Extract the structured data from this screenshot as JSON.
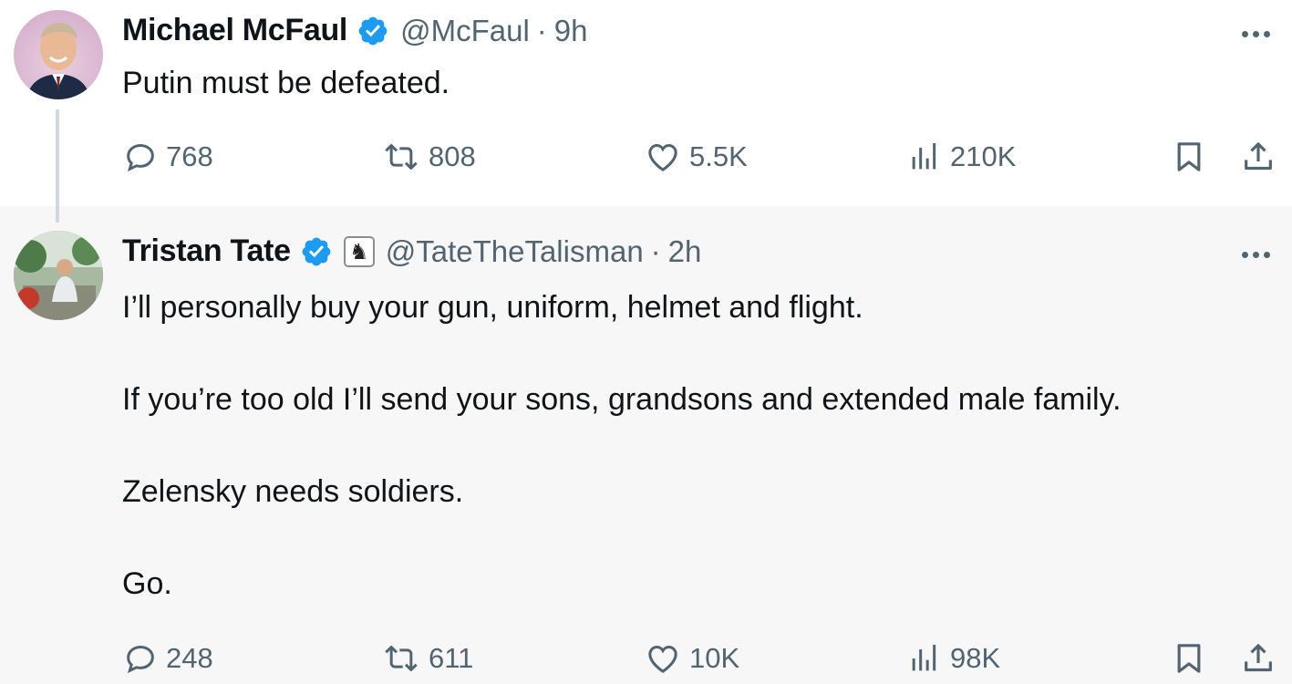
{
  "tweets": [
    {
      "author_name": "Michael McFaul",
      "handle": "@McFaul",
      "separator": "·",
      "time": "9h",
      "verified": true,
      "text_lines": [
        "Putin must be defeated."
      ],
      "stats": {
        "replies": "768",
        "retweets": "808",
        "likes": "5.5K",
        "views": "210K"
      }
    },
    {
      "author_name": "Tristan Tate",
      "handle": "@TateTheTalisman",
      "separator": "·",
      "time": "2h",
      "verified": true,
      "affiliate_badge": "chess-knight",
      "text_lines": [
        "I’ll personally buy your gun, uniform, helmet and flight.",
        "If you’re too old I’ll send your sons, grandsons and extended male family.",
        "Zelensky needs soldiers.",
        "Go."
      ],
      "stats": {
        "replies": "248",
        "retweets": "611",
        "likes": "10K",
        "views": "98K"
      }
    }
  ],
  "colors": {
    "verified_blue": "#1d9bf0",
    "muted_text": "#536471",
    "primary_text": "#0f1419",
    "reply_background": "#f7f7f8"
  },
  "icons": [
    "more-icon",
    "reply-icon",
    "retweet-icon",
    "like-icon",
    "views-icon",
    "bookmark-icon",
    "share-icon",
    "verified-icon"
  ]
}
